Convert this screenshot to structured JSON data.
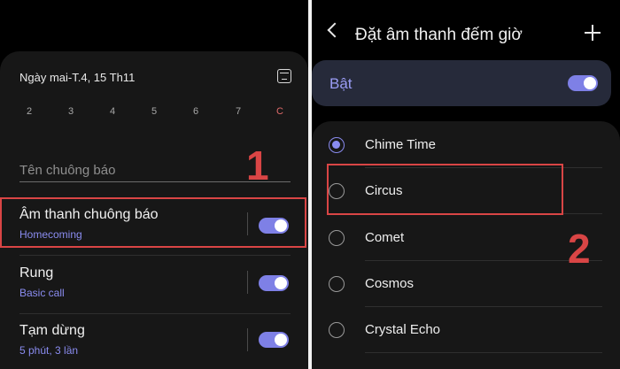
{
  "left": {
    "date_label": "Ngày mai-T.4, 15 Th11",
    "days": [
      "2",
      "3",
      "4",
      "5",
      "6",
      "7",
      "C"
    ],
    "name_placeholder": "Tên chuông báo",
    "marker": "1",
    "rows": [
      {
        "title": "Âm thanh chuông báo",
        "subtitle": "Homecoming",
        "enabled": true
      },
      {
        "title": "Rung",
        "subtitle": "Basic call",
        "enabled": true
      },
      {
        "title": "Tạm dừng",
        "subtitle": "5 phút, 3 lần",
        "enabled": true
      }
    ]
  },
  "right": {
    "title": "Đặt âm thanh đếm giờ",
    "master_label": "Bật",
    "master_enabled": true,
    "marker": "2",
    "options": [
      {
        "label": "Chime Time",
        "selected": true
      },
      {
        "label": "Circus",
        "selected": false
      },
      {
        "label": "Comet",
        "selected": false
      },
      {
        "label": "Cosmos",
        "selected": false
      },
      {
        "label": "Crystal Echo",
        "selected": false
      }
    ]
  },
  "colors": {
    "accent": "#8a8cf0",
    "toggle_on": "#7e80e6",
    "highlight": "#d94545",
    "card": "#171717",
    "master_card": "#262a3a"
  }
}
